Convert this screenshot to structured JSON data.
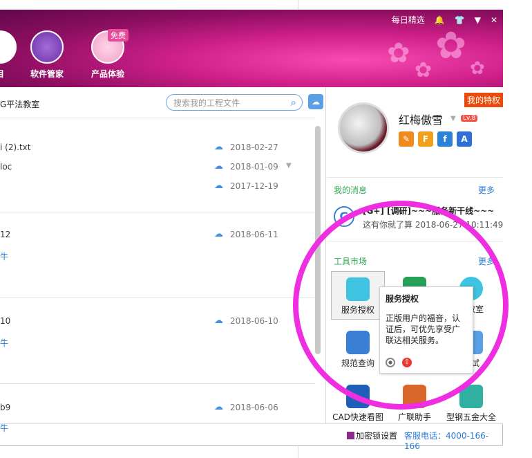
{
  "header": {
    "top_links": {
      "daily": "每日精选",
      "bell": "🔔",
      "shirt": "👕",
      "menu": "▼",
      "close": "✕"
    },
    "nav": [
      {
        "label": "目"
      },
      {
        "label": "软件管家"
      },
      {
        "label": "产品体验"
      }
    ],
    "free_badge": "免费"
  },
  "left": {
    "title": "G平法教室",
    "search_placeholder": "搜索我的工程文件",
    "files": [
      {
        "name": "i (2).txt",
        "date": "2018-02-27"
      },
      {
        "name": "loc",
        "date": "2018-01-09"
      },
      {
        "name": "",
        "date": "2017-12-19"
      },
      {
        "name": "12",
        "date": "2018-06-11"
      },
      {
        "name": "10",
        "date": "2018-06-10"
      },
      {
        "name": "b9",
        "date": "2018-06-06"
      }
    ],
    "link_text": "牛"
  },
  "right": {
    "vip_label": "我的特权",
    "username": "红梅傲雪",
    "level": "Lv.8",
    "messages_title": "我的消息",
    "more": "更多",
    "msg_line1": "[G+] [调研]~~~服务新干线~~~",
    "msg_line2": "这有你就了算 2018-06-27 10:11:49",
    "tools_title": "工具市场",
    "tools": [
      {
        "label": "服务授权"
      },
      {
        "label": ""
      },
      {
        "label": "法教室"
      },
      {
        "label": "规范查询"
      },
      {
        "label": ""
      },
      {
        "label": "考试"
      },
      {
        "label": "CAD快速看图"
      },
      {
        "label": "广联助手"
      },
      {
        "label": "型钢五金大全"
      }
    ]
  },
  "tooltip": {
    "title": "服务授权",
    "body": "正版用户的福音，认证后，可优先享受广联达相关服务。"
  },
  "footer": {
    "lock": "加密锁设置",
    "phone": "客服电话：4000-166-166"
  }
}
